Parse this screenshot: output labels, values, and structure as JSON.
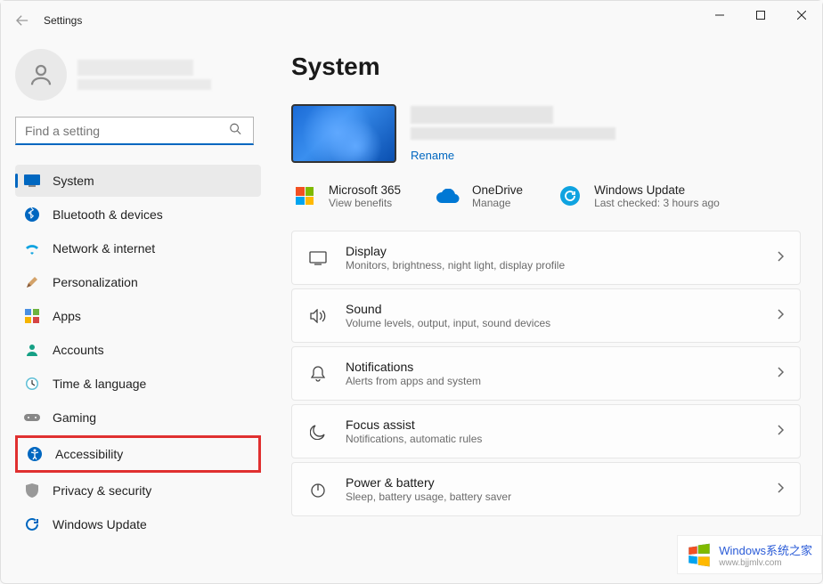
{
  "window": {
    "title": "Settings"
  },
  "search": {
    "placeholder": "Find a setting"
  },
  "nav": {
    "system": "System",
    "bluetooth": "Bluetooth & devices",
    "network": "Network & internet",
    "personalization": "Personalization",
    "apps": "Apps",
    "accounts": "Accounts",
    "time": "Time & language",
    "gaming": "Gaming",
    "accessibility": "Accessibility",
    "privacy": "Privacy & security",
    "update": "Windows Update"
  },
  "page": {
    "title": "System",
    "rename": "Rename"
  },
  "quick": {
    "ms365": {
      "title": "Microsoft 365",
      "sub": "View benefits"
    },
    "onedrive": {
      "title": "OneDrive",
      "sub": "Manage"
    },
    "update": {
      "title": "Windows Update",
      "sub": "Last checked: 3 hours ago"
    }
  },
  "settings": {
    "display": {
      "title": "Display",
      "sub": "Monitors, brightness, night light, display profile"
    },
    "sound": {
      "title": "Sound",
      "sub": "Volume levels, output, input, sound devices"
    },
    "notifications": {
      "title": "Notifications",
      "sub": "Alerts from apps and system"
    },
    "focus": {
      "title": "Focus assist",
      "sub": "Notifications, automatic rules"
    },
    "power": {
      "title": "Power & battery",
      "sub": "Sleep, battery usage, battery saver"
    }
  },
  "watermark": {
    "text": "Windows系统之家",
    "url": "www.bjjmlv.com"
  }
}
